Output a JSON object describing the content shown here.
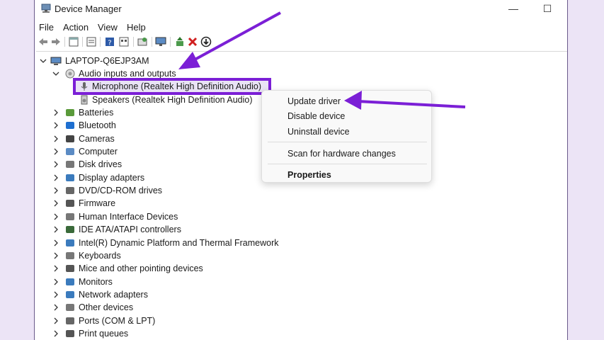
{
  "window": {
    "title": "Device Manager",
    "minimize_glyph": "—",
    "maximize_glyph": "☐"
  },
  "menu": [
    "File",
    "Action",
    "View",
    "Help"
  ],
  "toolbar_icons": [
    "back-icon",
    "forward-icon",
    "properties-icon",
    "details-icon",
    "help-icon",
    "list-icon",
    "scan-icon",
    "monitor-icon",
    "add-driver-icon",
    "uninstall-icon",
    "update-icon"
  ],
  "tree": {
    "root": "LAPTOP-Q6EJP3AM",
    "expanded_category": "Audio inputs and outputs",
    "children": [
      "Microphone (Realtek High Definition Audio)",
      "Speakers (Realtek High Definition Audio)"
    ],
    "categories": [
      "Batteries",
      "Bluetooth",
      "Cameras",
      "Computer",
      "Disk drives",
      "Display adapters",
      "DVD/CD-ROM drives",
      "Firmware",
      "Human Interface Devices",
      "IDE ATA/ATAPI controllers",
      "Intel(R) Dynamic Platform and Thermal Framework",
      "Keyboards",
      "Mice and other pointing devices",
      "Monitors",
      "Network adapters",
      "Other devices",
      "Ports (COM & LPT)",
      "Print queues"
    ]
  },
  "context_menu": {
    "update_driver": "Update driver",
    "disable_device": "Disable device",
    "uninstall_device": "Uninstall device",
    "scan_hardware": "Scan for hardware changes",
    "properties": "Properties"
  },
  "colors": {
    "annotation_purple": "#7b1fd6",
    "selection_bg": "#e9e3f5"
  }
}
